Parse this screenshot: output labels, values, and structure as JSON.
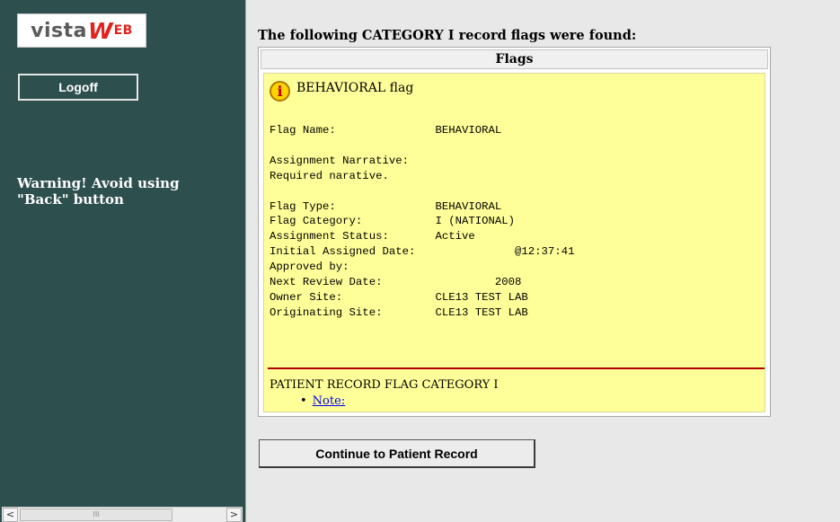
{
  "sidebar": {
    "logo": {
      "part1": "vista",
      "part2": "W",
      "part3": "EB"
    },
    "logoff_label": "Logoff",
    "warning_text": "Warning! Avoid using \"Back\" button",
    "scrollbar": {
      "left_arrow": "<",
      "right_arrow": ">",
      "thumb_grip": "III"
    }
  },
  "main": {
    "heading": "The following CATEGORY I record flags were found:",
    "flags_header": "Flags",
    "flag_icon": "info-icon",
    "flag_icon_glyph": "i",
    "flag_title": "BEHAVIORAL flag",
    "details_text": "Flag Name:               BEHAVIORAL\n\nAssignment Narrative:\nRequired narative.\n\nFlag Type:               BEHAVIORAL\nFlag Category:           I (NATIONAL)\nAssignment Status:       Active\nInitial Assigned Date:               @12:37:41\nApproved by:\nNext Review Date:                 2008\nOwner Site:              CLE13 TEST LAB\nOriginating Site:        CLE13 TEST LAB",
    "category_text": "PATIENT RECORD FLAG CATEGORY I",
    "note_bullet": "•",
    "note_link": "Note:",
    "continue_label": "Continue to Patient Record"
  },
  "colors": {
    "sidebar_bg": "#2d4f4d",
    "flag_bg": "#ffff99",
    "separator": "#b00000",
    "logo_accent": "#e0231c"
  }
}
